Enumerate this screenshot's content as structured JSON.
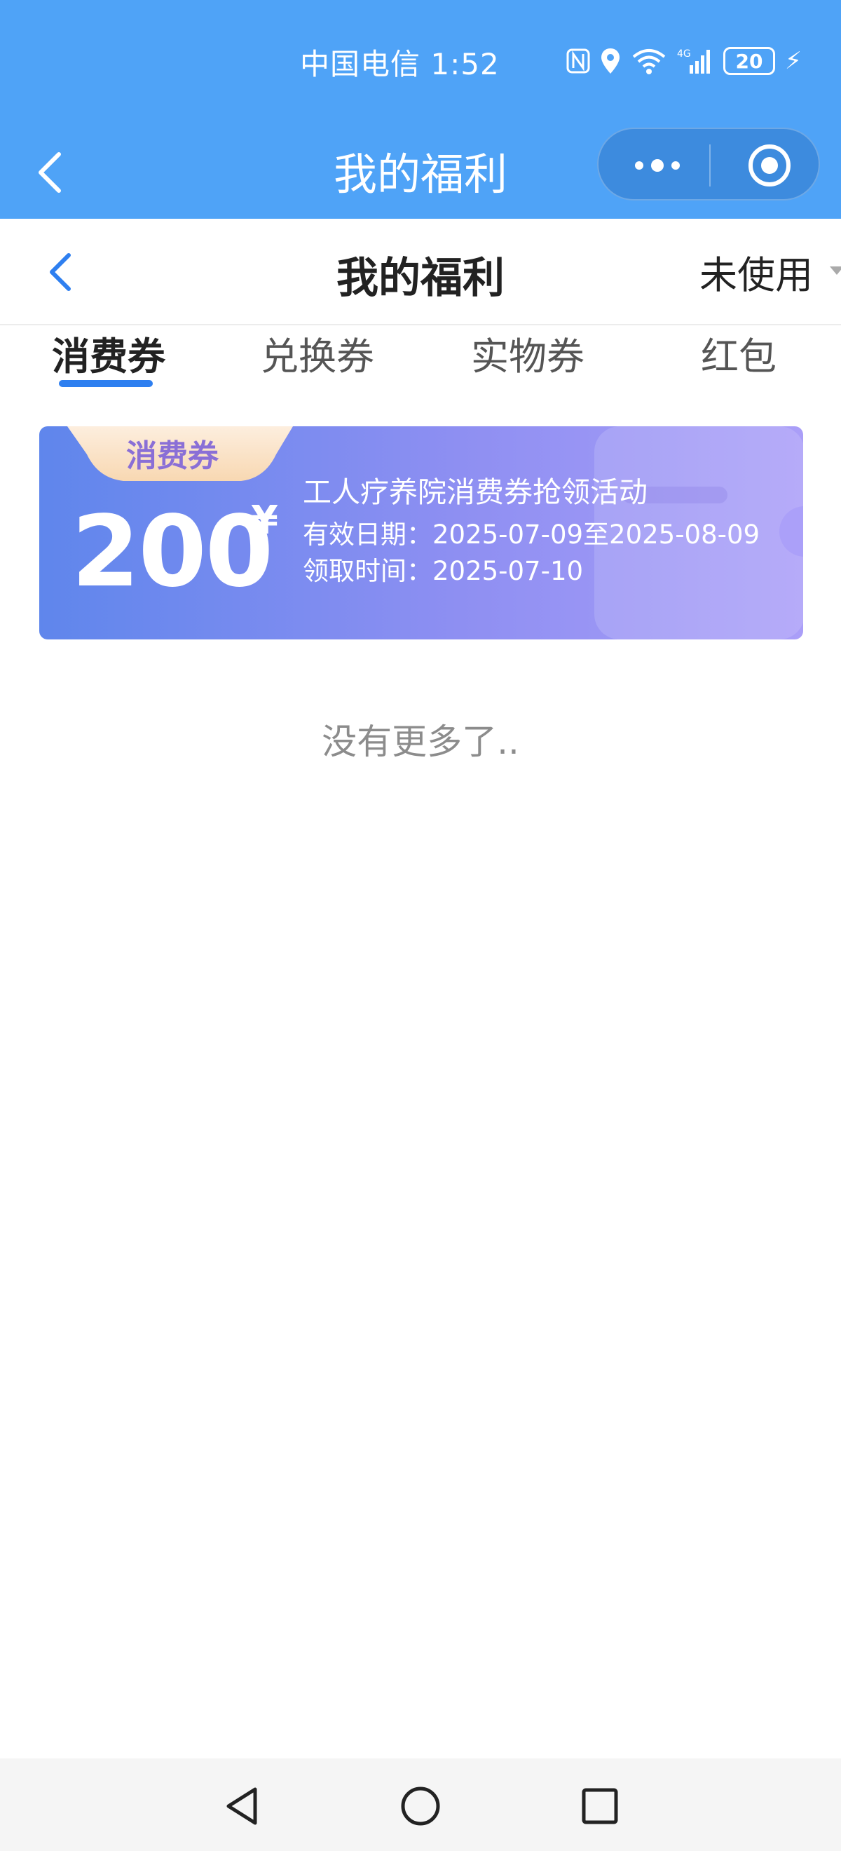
{
  "status_bar": {
    "carrier_time": "中国电信 1:52",
    "battery": "20",
    "icons": [
      "nfc-icon",
      "location-icon",
      "wifi-icon",
      "signal-icon",
      "battery-icon",
      "charging-icon"
    ]
  },
  "mini_program_bar": {
    "title": "我的福利",
    "back_icon": "chevron-left-icon",
    "menu_icon": "more-dots-icon",
    "close_icon": "target-icon"
  },
  "page_header": {
    "title": "我的福利",
    "filter_label": "未使用"
  },
  "tabs": [
    {
      "label": "消费券",
      "active": true
    },
    {
      "label": "兑换券",
      "active": false
    },
    {
      "label": "实物券",
      "active": false
    },
    {
      "label": "红包",
      "active": false
    }
  ],
  "coupons": [
    {
      "tag": "消费券",
      "amount": "200",
      "currency": "¥",
      "title": "工人疗养院消费券抢领活动",
      "valid_period": "有效日期：2025-07-09至2025-08-09",
      "claim_time": "领取时间：2025-07-10"
    }
  ],
  "list_end_text": "没有更多了..",
  "colors": {
    "header_blue": "#4fa3f7",
    "accent_blue": "#2e7ff0",
    "coupon_gradient_start": "#5f86ec",
    "coupon_gradient_end": "#aa9ef8",
    "tag_bg": "#fbe3c4"
  }
}
